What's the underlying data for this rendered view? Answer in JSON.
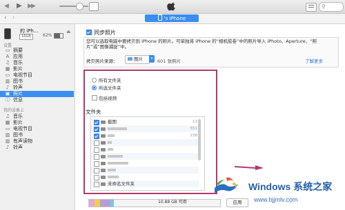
{
  "toolbar": {
    "back_icon": "◀",
    "play_icon": "▶",
    "forward_icon": "▶▶",
    "search_icon": "⚲"
  },
  "nav": {
    "back": "‹",
    "forward": "›",
    "device_label": "'s iPhone"
  },
  "sidebar": {
    "device_name": "的 iPh...",
    "capacity": "16GB",
    "battery": "62%",
    "section_settings": "设置",
    "settings_items": [
      {
        "label": "摘要",
        "icon": "▭"
      },
      {
        "label": "应用",
        "icon": "A"
      },
      {
        "label": "音乐",
        "icon": "♫"
      },
      {
        "label": "影片",
        "icon": "▦"
      },
      {
        "label": "电视节目",
        "icon": "▭"
      },
      {
        "label": "图书",
        "icon": "▥"
      },
      {
        "label": "铃声",
        "icon": "♪"
      },
      {
        "label": "照片",
        "icon": "▣"
      },
      {
        "label": "信息",
        "icon": "ⓘ"
      }
    ],
    "section_on_device": "我的设备上",
    "device_items": [
      {
        "label": "音乐",
        "icon": "♫"
      },
      {
        "label": "影片",
        "icon": "▦"
      },
      {
        "label": "电视节目",
        "icon": "▭"
      },
      {
        "label": "图书",
        "icon": "▥"
      },
      {
        "label": "有声读物",
        "icon": "▥"
      },
      {
        "label": "铃声",
        "icon": "♪"
      }
    ]
  },
  "main": {
    "sync_label": "同步照片",
    "info_text": "您可以选取电脑中要拷贝到 iPhone 的照片。可单独将 iPhone 的“相机胶卷”中的照片导入 iPhoto、Aperture、“照片”或“图像捕捉”中。",
    "source_label": "拷贝照片来源：",
    "source_value": "图片",
    "source_arrow": "▾",
    "photo_count": "601 张照片",
    "learn_more": "了解更多",
    "radio_all": "所有文件夹",
    "radio_selected": "所选文件夹",
    "include_videos": "包括视频",
    "folders_title": "文件夹",
    "folders": [
      {
        "name": "截图",
        "count": "12",
        "checked": true
      },
      {
        "name": "",
        "count": "551",
        "checked": true
      },
      {
        "name": "",
        "count": "238",
        "checked": true
      },
      {
        "name": "",
        "count": "",
        "checked": false
      },
      {
        "name": "",
        "count": "",
        "checked": false
      },
      {
        "name": "",
        "count": "",
        "checked": false
      },
      {
        "name": "",
        "count": "",
        "checked": false
      },
      {
        "name": "",
        "count": "",
        "checked": false
      },
      {
        "name": "",
        "count": "",
        "checked": false
      },
      {
        "name": "未命名文件夹",
        "count": "",
        "checked": false
      }
    ]
  },
  "storage": {
    "free_text": "10.88 GB 可用",
    "apply": "应用",
    "colors": [
      "#e5a8d8",
      "#f2cd4a",
      "#b99cd6",
      "#7ec1e8"
    ]
  },
  "watermark": {
    "title": "Windows ",
    "title_cn": "系统之家",
    "url": "www.bjjmlv.com"
  },
  "colors": {
    "accent": "#3a8ef0",
    "highlight": "#b2396b",
    "watermark": "#2561a8"
  }
}
